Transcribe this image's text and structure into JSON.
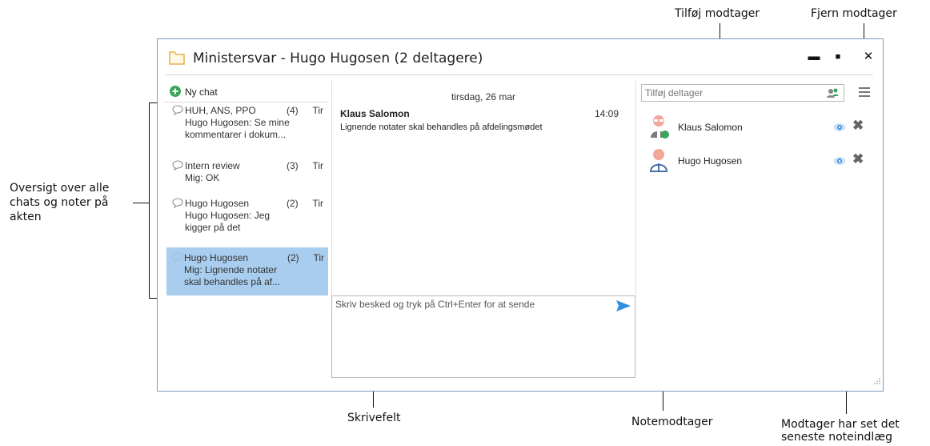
{
  "annotations": {
    "add_recipient": "Tilføj modtager",
    "remove_recipient": "Fjern modtager",
    "overview": [
      "Oversigt over alle",
      "chats og noter på",
      "akten"
    ],
    "compose_field": "Skrivefelt",
    "note_recipient": "Notemodtager",
    "seen": [
      "Modtager har set det",
      "seneste noteindlæg"
    ]
  },
  "window": {
    "title": "Ministersvar - Hugo Hugosen (2 deltagere)",
    "icon": "folder-icon",
    "controls": {
      "minimize": "▬",
      "maximize": "■",
      "close": "✕"
    }
  },
  "sidebar": {
    "new_chat_label": "Ny chat",
    "chats": [
      {
        "name": "HUH, ANS, PPO",
        "count": "(4)",
        "day": "Tir",
        "preview_lines": [
          "Hugo Hugosen: Se mine",
          "kommentarer i dokum..."
        ],
        "active": false
      },
      {
        "name": "Intern review",
        "count": "(3)",
        "day": "Tir",
        "preview_lines": [
          "Mig: OK"
        ],
        "active": false
      },
      {
        "name": "Hugo Hugosen",
        "count": "(2)",
        "day": "Tir",
        "preview_lines": [
          "Hugo Hugosen: Jeg",
          "kigger på det"
        ],
        "active": false
      },
      {
        "name": "Hugo Hugosen",
        "count": "(2)",
        "day": "Tir",
        "preview_lines": [
          "Mig: Lignende notater",
          "skal behandles på af..."
        ],
        "active": true
      }
    ]
  },
  "messages": {
    "date": "tirsdag, 26 mar",
    "items": [
      {
        "author": "Klaus Salomon",
        "time": "14:09",
        "text": "Lignende notater skal behandles på afdelingsmødet"
      }
    ]
  },
  "compose": {
    "placeholder": "Skriv besked og tryk på Ctrl+Enter for at sende",
    "send_icon": "send-arrow-icon"
  },
  "participants_panel": {
    "add_placeholder": "Tilføj deltager",
    "participants": [
      {
        "name": "Klaus Salomon",
        "seen": true
      },
      {
        "name": "Hugo Hugosen",
        "seen": true
      }
    ]
  },
  "colors": {
    "active_chat": "#a9cdee",
    "send_arrow": "#2e8fe0",
    "window_border": "#7a9cc6",
    "new_chat_icon": "#3aa55c"
  }
}
